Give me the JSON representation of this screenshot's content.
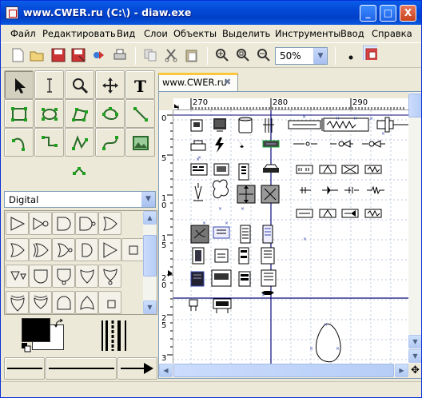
{
  "window": {
    "title": "www.CWER.ru (C:\\) - diaw.exe",
    "controls": {
      "minimize": "_",
      "maximize": "□",
      "close": "X"
    }
  },
  "menu": {
    "items": [
      "Файл",
      "Редактировать",
      "Вид",
      "Слои",
      "Объекты",
      "Выделить",
      "Инструменты",
      "Ввод",
      "Справка"
    ]
  },
  "toolbar": {
    "icons": [
      "new-icon",
      "open-icon",
      "save-icon",
      "save-as-icon",
      "export-icon",
      "print-icon",
      "copy-icon",
      "cut-icon",
      "paste-icon",
      "zoom-in-icon",
      "zoom-fit-icon",
      "zoom-out-icon",
      "snap-icon",
      "grid-icon"
    ],
    "zoom_value": "50%"
  },
  "tools": {
    "items": [
      "pointer",
      "text-cursor",
      "magnify",
      "move",
      "text",
      "box",
      "ellipse",
      "polygon",
      "beziergon",
      "line",
      "arc",
      "zigzag",
      "polyline",
      "bezier",
      "image",
      "outline"
    ]
  },
  "sheet": {
    "selected": "Digital"
  },
  "colors": {
    "foreground": "#000000",
    "background": "#ffffff"
  },
  "tab": {
    "label": "www.CWER.ru",
    "close": "✖"
  },
  "ruler": {
    "h_labels": [
      "270",
      "280",
      "290"
    ],
    "v_labels": [
      [
        "0"
      ],
      [
        "5"
      ],
      [
        "1",
        "0"
      ],
      [
        "1",
        "5"
      ],
      [
        "2",
        "0"
      ],
      [
        "2",
        "5"
      ],
      [
        "3"
      ]
    ]
  },
  "nav_icon": "✥"
}
